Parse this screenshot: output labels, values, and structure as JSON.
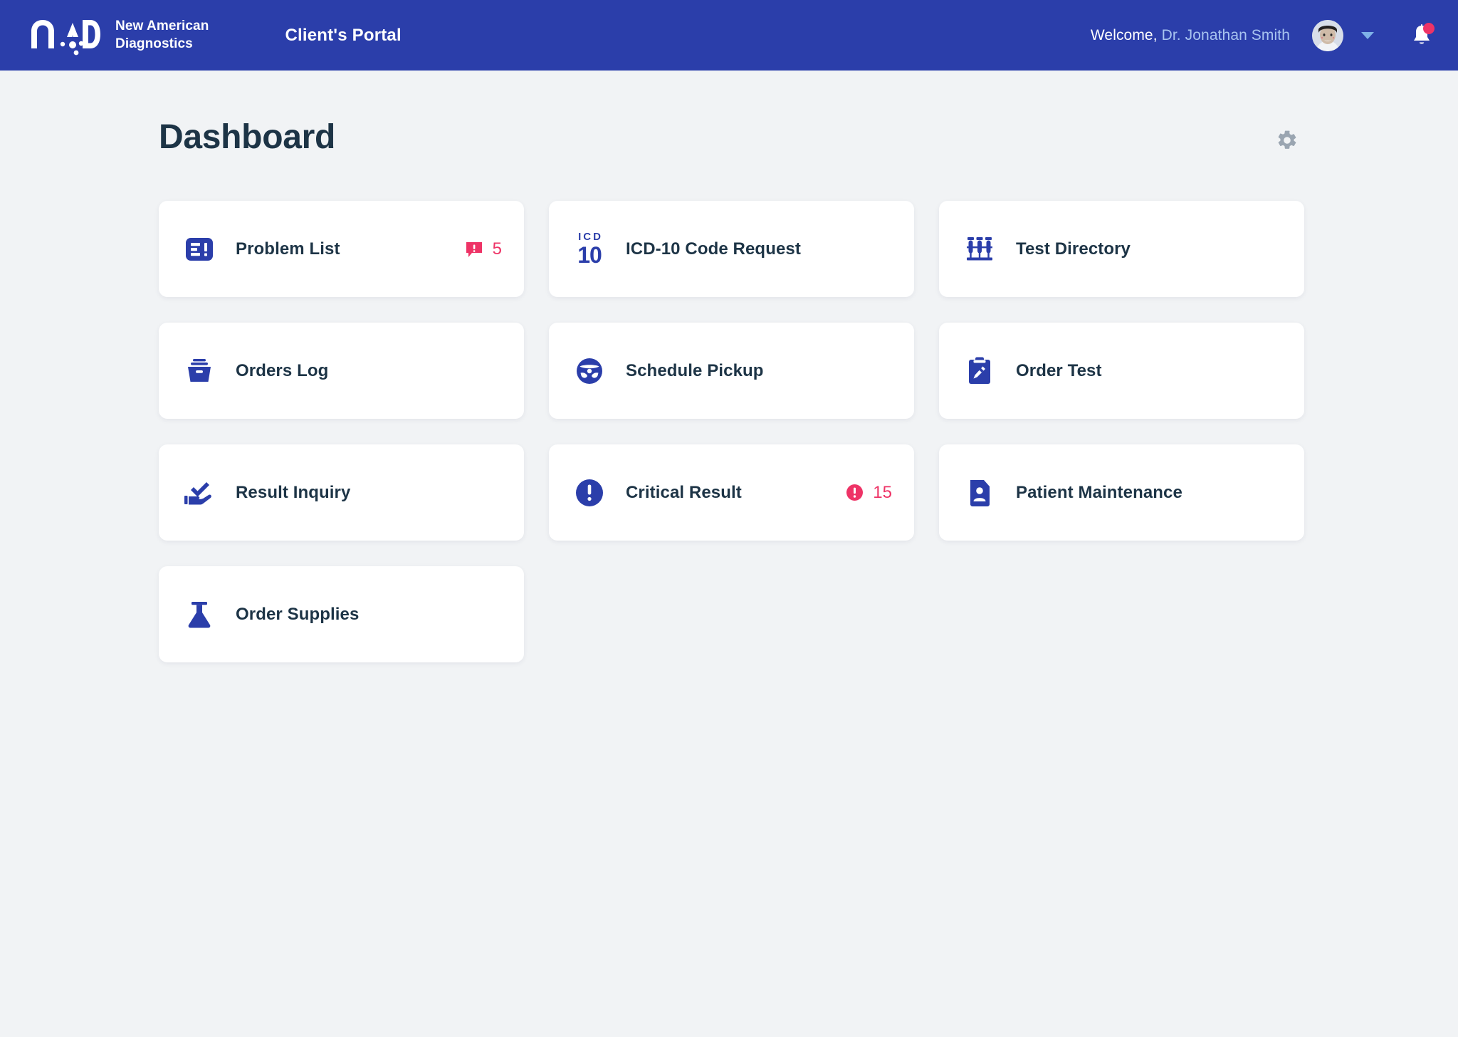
{
  "header": {
    "logo_icon": "nad-logo-icon",
    "brand_name": "New American\nDiagnostics",
    "portal_title": "Client's Portal",
    "welcome_prefix": "Welcome, ",
    "user_name": "Dr. Jonathan Smith",
    "avatar_icon": "user-avatar",
    "dropdown_icon": "chevron-down-icon",
    "notification_icon": "bell-icon",
    "has_notification": true,
    "background_color": "#2b3eaa",
    "username_color": "#a8c4f0"
  },
  "page": {
    "title": "Dashboard",
    "settings_icon": "gear-icon",
    "background_color": "#f1f3f5"
  },
  "cards": [
    {
      "label": "Problem List",
      "icon": "problem-list-icon",
      "badge": {
        "count": "5",
        "icon": "alert-comment-icon",
        "color": "#ee3366"
      }
    },
    {
      "label": "ICD-10 Code Request",
      "icon": "icd-10-icon",
      "icd_top": "ICD",
      "icd_bottom": "10",
      "badge": null
    },
    {
      "label": "Test Directory",
      "icon": "test-tubes-icon",
      "badge": null
    },
    {
      "label": "Orders Log",
      "icon": "tray-icon",
      "badge": null
    },
    {
      "label": "Schedule Pickup",
      "icon": "steering-wheel-icon",
      "badge": null
    },
    {
      "label": "Order Test",
      "icon": "clipboard-tube-icon",
      "badge": null
    },
    {
      "label": "Result Inquiry",
      "icon": "hand-check-icon",
      "badge": null
    },
    {
      "label": "Critical Result",
      "icon": "alert-circle-icon",
      "badge": {
        "count": "15",
        "icon": "alert-circle-badge-icon",
        "color": "#ee3366"
      }
    },
    {
      "label": "Patient Maintenance",
      "icon": "patient-file-icon",
      "badge": null
    },
    {
      "label": "Order Supplies",
      "icon": "flask-icon",
      "badge": null
    }
  ],
  "colors": {
    "brand_blue": "#2b3eaa",
    "accent_pink": "#ee3366",
    "text_dark": "#1d3446",
    "card_white": "#ffffff"
  }
}
